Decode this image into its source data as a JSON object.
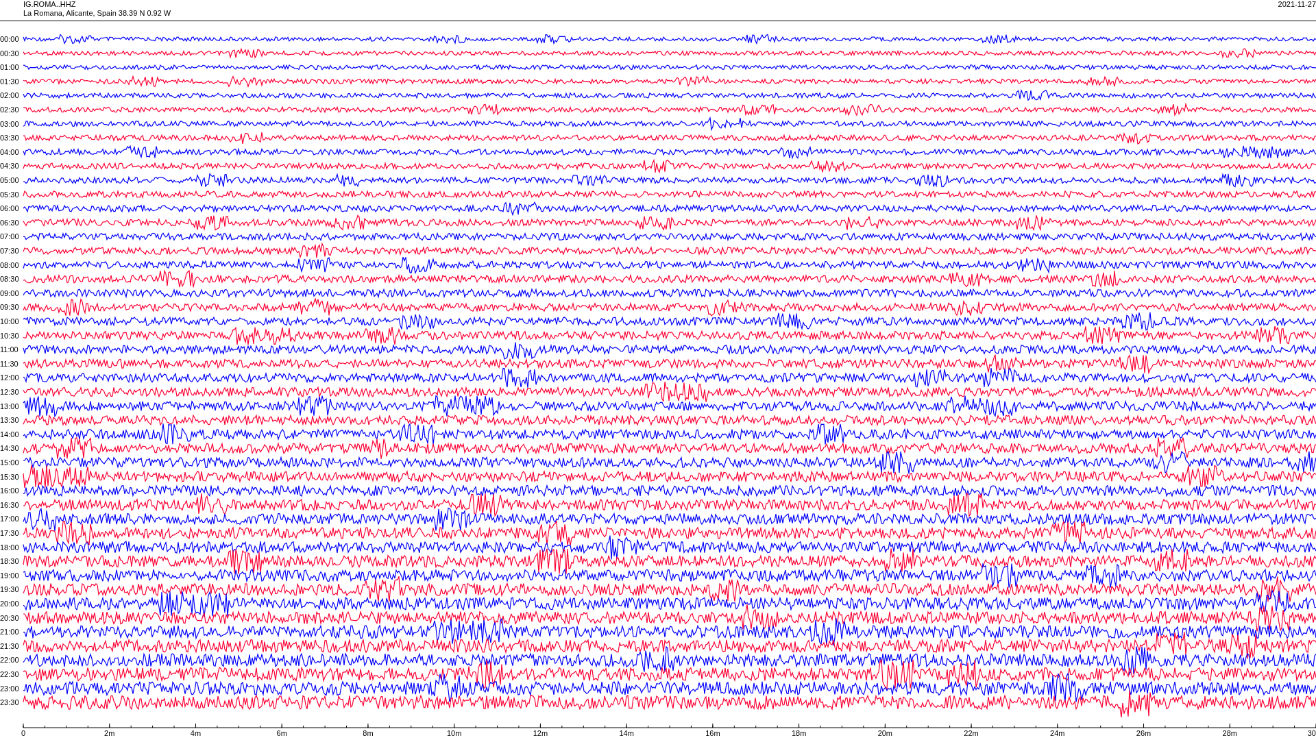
{
  "header": {
    "station": "IG.ROMA..HHZ",
    "location": "La Romana, Alicante, Spain  38.39 N 0.92 W",
    "date": "2021-11-27"
  },
  "traces": [
    {
      "label": "00:00",
      "color": "#0000ff"
    },
    {
      "label": "00:30",
      "color": "#ff0033"
    },
    {
      "label": "01:00",
      "color": "#0000ff"
    },
    {
      "label": "01:30",
      "color": "#ff0033"
    },
    {
      "label": "02:00",
      "color": "#0000ff"
    },
    {
      "label": "02:30",
      "color": "#ff0033"
    },
    {
      "label": "03:00",
      "color": "#0000ff"
    },
    {
      "label": "03:30",
      "color": "#ff0033"
    },
    {
      "label": "04:00",
      "color": "#0000ff"
    },
    {
      "label": "04:30",
      "color": "#ff0033"
    },
    {
      "label": "05:00",
      "color": "#0000ff"
    },
    {
      "label": "05:30",
      "color": "#ff0033"
    },
    {
      "label": "06:00",
      "color": "#0000ff"
    },
    {
      "label": "06:30",
      "color": "#ff0033"
    },
    {
      "label": "07:00",
      "color": "#0000ff"
    },
    {
      "label": "07:30",
      "color": "#ff0033"
    },
    {
      "label": "08:00",
      "color": "#0000ff"
    },
    {
      "label": "08:30",
      "color": "#ff0033"
    },
    {
      "label": "09:00",
      "color": "#0000ff"
    },
    {
      "label": "09:30",
      "color": "#ff0033"
    },
    {
      "label": "10:00",
      "color": "#0000ff"
    },
    {
      "label": "10:30",
      "color": "#ff0033"
    },
    {
      "label": "11:00",
      "color": "#0000ff"
    },
    {
      "label": "11:30",
      "color": "#ff0033"
    },
    {
      "label": "12:00",
      "color": "#0000ff"
    },
    {
      "label": "12:30",
      "color": "#ff0033"
    },
    {
      "label": "13:00",
      "color": "#0000ff"
    },
    {
      "label": "13:30",
      "color": "#ff0033"
    },
    {
      "label": "14:00",
      "color": "#0000ff"
    },
    {
      "label": "14:30",
      "color": "#ff0033"
    },
    {
      "label": "15:00",
      "color": "#0000ff"
    },
    {
      "label": "15:30",
      "color": "#ff0033"
    },
    {
      "label": "16:00",
      "color": "#0000ff"
    },
    {
      "label": "16:30",
      "color": "#ff0033"
    },
    {
      "label": "17:00",
      "color": "#0000ff"
    },
    {
      "label": "17:30",
      "color": "#ff0033"
    },
    {
      "label": "18:00",
      "color": "#0000ff"
    },
    {
      "label": "18:30",
      "color": "#ff0033"
    },
    {
      "label": "19:00",
      "color": "#0000ff"
    },
    {
      "label": "19:30",
      "color": "#ff0033"
    },
    {
      "label": "20:00",
      "color": "#0000ff"
    },
    {
      "label": "20:30",
      "color": "#ff0033"
    },
    {
      "label": "21:00",
      "color": "#0000ff"
    },
    {
      "label": "21:30",
      "color": "#ff0033"
    },
    {
      "label": "22:00",
      "color": "#0000ff"
    },
    {
      "label": "22:30",
      "color": "#ff0033"
    },
    {
      "label": "23:00",
      "color": "#0000ff"
    },
    {
      "label": "23:30",
      "color": "#ff0033"
    }
  ],
  "axis": {
    "labels": [
      "0",
      "2m",
      "4m",
      "6m",
      "8m",
      "10m",
      "12m",
      "14m",
      "16m",
      "18m",
      "20m",
      "22m",
      "24m",
      "26m",
      "28m",
      "30"
    ]
  }
}
